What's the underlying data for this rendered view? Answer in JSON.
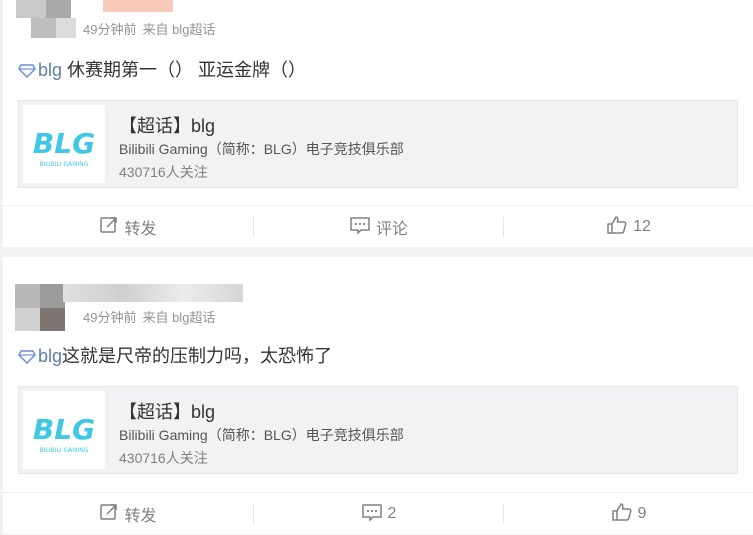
{
  "posts": [
    {
      "meta": {
        "time": "49分钟前",
        "source": "来自 blg超话"
      },
      "content": {
        "topic": "blg",
        "text": " 休赛期第一（）  亚运金牌（）"
      },
      "card": {
        "title": "【超话】blg",
        "description": "Bilibili Gaming（简称：BLG）电子竞技俱乐部",
        "followers": "430716人关注",
        "logo_text": "BLG",
        "logo_sub": "BILIBILI GAMING"
      },
      "actions": {
        "repost": "转发",
        "comment": "评论",
        "like": "12"
      }
    },
    {
      "meta": {
        "time": "49分钟前",
        "source": "来自 blg超话"
      },
      "content": {
        "topic": "blg",
        "text": "这就是尺帝的压制力吗，太恐怖了"
      },
      "card": {
        "title": "【超话】blg",
        "description": "Bilibili Gaming（简称：BLG）电子竞技俱乐部",
        "followers": "430716人关注",
        "logo_text": "BLG",
        "logo_sub": "BILIBILI GAMING"
      },
      "actions": {
        "repost": "转发",
        "comment": "2",
        "like": "9"
      }
    }
  ],
  "colors": {
    "logo": "#3fc8e4",
    "topic": "#5d7fa8",
    "meta": "#939393"
  },
  "icons": [
    "diamond-icon",
    "repost-icon",
    "comment-icon",
    "like-icon"
  ]
}
